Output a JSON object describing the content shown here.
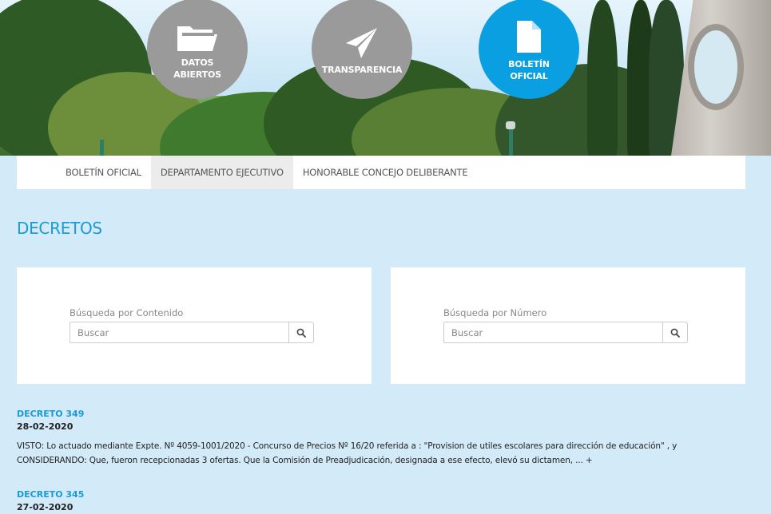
{
  "header": {
    "circles": [
      {
        "label": "DATOS\nABIERTOS",
        "icon": "folder-icon"
      },
      {
        "label": "TRANSPARENCIA",
        "icon": "paper-plane-icon"
      },
      {
        "label": "BOLETÍN\nOFICIAL",
        "icon": "document-icon"
      }
    ]
  },
  "tabs": [
    {
      "label": "BOLETÍN OFICIAL",
      "active": false
    },
    {
      "label": "DEPARTAMENTO EJECUTIVO",
      "active": true
    },
    {
      "label": "HONORABLE CONCEJO DELIBERANTE",
      "active": false
    }
  ],
  "page": {
    "title": "DECRETOS"
  },
  "search": {
    "content": {
      "label": "Búsqueda por Contenido",
      "placeholder": "Buscar"
    },
    "number": {
      "label": "Búsqueda por Número",
      "placeholder": "Buscar"
    }
  },
  "results": [
    {
      "title": "DECRETO 349",
      "date": "28-02-2020",
      "text": "VISTO: Lo actuado mediante Expte. Nº 4059-1001/2020 - Concurso de Precios Nº 16/20 referida a : \"Provision de utiles escolares para dirección de educación\" , y CONSIDERANDO: Que, fueron recepcionadas 3 ofertas. Que la Comisión de Preadjudicación, designada a ese efecto, elevó su dictamen, ... +"
    },
    {
      "title": "DECRETO 345",
      "date": "27-02-2020"
    }
  ],
  "colors": {
    "accent": "#1a9ad6",
    "active_circle": "#0a9fe0",
    "page_bg": "#d3eaf9"
  }
}
